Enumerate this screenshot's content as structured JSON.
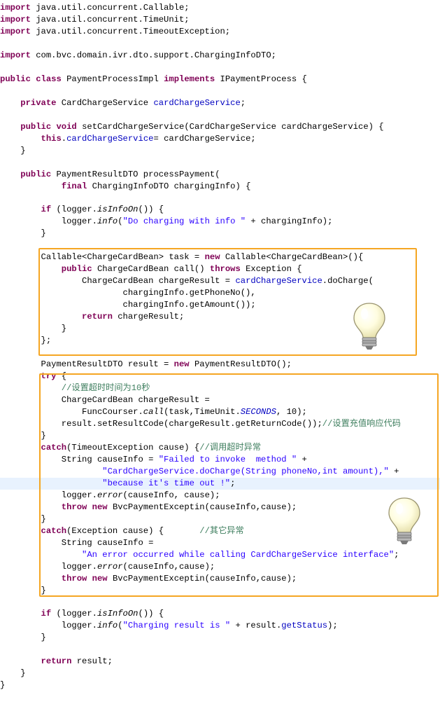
{
  "code_lines": [
    [
      {
        "t": "import",
        "c": "kw"
      },
      {
        "t": " java.util.concurrent.Callable;"
      }
    ],
    [
      {
        "t": "import",
        "c": "kw"
      },
      {
        "t": " java.util.concurrent.TimeUnit;"
      }
    ],
    [
      {
        "t": "import",
        "c": "kw"
      },
      {
        "t": " java.util.concurrent.TimeoutException;"
      }
    ],
    [],
    [
      {
        "t": "import",
        "c": "kw"
      },
      {
        "t": " com.bvc.domain.ivr.dto.support.ChargingInfoDTO;"
      }
    ],
    [],
    [
      {
        "t": "public",
        "c": "kw"
      },
      {
        "t": " "
      },
      {
        "t": "class",
        "c": "kw"
      },
      {
        "t": " PaymentProcessImpl "
      },
      {
        "t": "implements",
        "c": "kw"
      },
      {
        "t": " IPaymentProcess {"
      }
    ],
    [],
    [
      {
        "t": "    "
      },
      {
        "t": "private",
        "c": "kw"
      },
      {
        "t": " CardChargeService "
      },
      {
        "t": "cardChargeService",
        "c": "fld"
      },
      {
        "t": ";"
      }
    ],
    [],
    [
      {
        "t": "    "
      },
      {
        "t": "public",
        "c": "kw"
      },
      {
        "t": " "
      },
      {
        "t": "void",
        "c": "kw"
      },
      {
        "t": " setCardChargeService(CardChargeService cardChargeService) {"
      }
    ],
    [
      {
        "t": "        "
      },
      {
        "t": "this",
        "c": "kw"
      },
      {
        "t": "."
      },
      {
        "t": "cardChargeService",
        "c": "fld"
      },
      {
        "t": "= cardChargeService;"
      }
    ],
    [
      {
        "t": "    }"
      }
    ],
    [],
    [
      {
        "t": "    "
      },
      {
        "t": "public",
        "c": "kw"
      },
      {
        "t": " PaymentResultDTO processPayment("
      }
    ],
    [
      {
        "t": "            "
      },
      {
        "t": "final",
        "c": "kw"
      },
      {
        "t": " ChargingInfoDTO chargingInfo) {"
      }
    ],
    [],
    [
      {
        "t": "        "
      },
      {
        "t": "if",
        "c": "kw"
      },
      {
        "t": " (logger."
      },
      {
        "t": "isInfoOn",
        "c": "itl"
      },
      {
        "t": "()) {"
      }
    ],
    [
      {
        "t": "            logger."
      },
      {
        "t": "info",
        "c": "itl"
      },
      {
        "t": "("
      },
      {
        "t": "\"Do charging with info \"",
        "c": "str"
      },
      {
        "t": " + chargingInfo);"
      }
    ],
    [
      {
        "t": "        }"
      }
    ],
    [],
    [
      {
        "t": "        Callable<ChargeCardBean> task = "
      },
      {
        "t": "new",
        "c": "kw"
      },
      {
        "t": " Callable<ChargeCardBean>(){"
      }
    ],
    [
      {
        "t": "            "
      },
      {
        "t": "public",
        "c": "kw"
      },
      {
        "t": " ChargeCardBean call() "
      },
      {
        "t": "throws",
        "c": "kw"
      },
      {
        "t": " Exception {"
      }
    ],
    [
      {
        "t": "                ChargeCardBean chargeResult = "
      },
      {
        "t": "cardChargeService",
        "c": "fld"
      },
      {
        "t": ".doCharge("
      }
    ],
    [
      {
        "t": "                        chargingInfo.getPhoneNo(),"
      }
    ],
    [
      {
        "t": "                        chargingInfo.getAmount());"
      }
    ],
    [
      {
        "t": "                "
      },
      {
        "t": "return",
        "c": "kw"
      },
      {
        "t": " chargeResult;"
      }
    ],
    [
      {
        "t": "            }"
      }
    ],
    [
      {
        "t": "        };"
      }
    ],
    [],
    [
      {
        "t": "        PaymentResultDTO result = "
      },
      {
        "t": "new",
        "c": "kw"
      },
      {
        "t": " PaymentResultDTO();"
      }
    ],
    [
      {
        "t": "        "
      },
      {
        "t": "try",
        "c": "kw"
      },
      {
        "t": " {"
      }
    ],
    [
      {
        "t": "            "
      },
      {
        "t": "//设置超时时间为10秒",
        "c": "cmt"
      }
    ],
    [
      {
        "t": "            ChargeCardBean chargeResult ="
      }
    ],
    [
      {
        "t": "                FuncCourser."
      },
      {
        "t": "call",
        "c": "itl"
      },
      {
        "t": "(task,TimeUnit."
      },
      {
        "t": "SECONDS",
        "c": "sitl"
      },
      {
        "t": ", 10);"
      }
    ],
    [
      {
        "t": "            result.setResultCode(chargeResult.getReturnCode());"
      },
      {
        "t": "//设置充值响应代码",
        "c": "cmt"
      }
    ],
    [
      {
        "t": "        }"
      }
    ],
    [
      {
        "t": "        "
      },
      {
        "t": "catch",
        "c": "kw"
      },
      {
        "t": "(TimeoutException cause) {"
      },
      {
        "t": "//调用超时异常",
        "c": "cmt"
      }
    ],
    [
      {
        "t": "            String causeInfo = "
      },
      {
        "t": "\"Failed to invoke  method \"",
        "c": "str"
      },
      {
        "t": " +"
      }
    ],
    [
      {
        "t": "                    "
      },
      {
        "t": "\"CardChargeService.doCharge(String phoneNo,int amount),\"",
        "c": "str"
      },
      {
        "t": " +"
      }
    ],
    [
      {
        "t": "                    "
      },
      {
        "t": "\"because it's time out !\"",
        "c": "str"
      },
      {
        "t": ";"
      }
    ],
    [
      {
        "t": "            logger."
      },
      {
        "t": "error",
        "c": "itl"
      },
      {
        "t": "(causeInfo, cause);"
      }
    ],
    [
      {
        "t": "            "
      },
      {
        "t": "throw",
        "c": "kw"
      },
      {
        "t": " "
      },
      {
        "t": "new",
        "c": "kw"
      },
      {
        "t": " BvcPaymentExceptin(causeInfo,cause);"
      }
    ],
    [
      {
        "t": "        }"
      }
    ],
    [
      {
        "t": "        "
      },
      {
        "t": "catch",
        "c": "kw"
      },
      {
        "t": "(Exception cause) {       "
      },
      {
        "t": "//其它异常",
        "c": "cmt"
      }
    ],
    [
      {
        "t": "            String causeInfo ="
      }
    ],
    [
      {
        "t": "                "
      },
      {
        "t": "\"An error occurred while calling CardChargeService interface\"",
        "c": "str"
      },
      {
        "t": ";"
      }
    ],
    [
      {
        "t": "            logger."
      },
      {
        "t": "error",
        "c": "itl"
      },
      {
        "t": "(causeInfo,cause);"
      }
    ],
    [
      {
        "t": "            "
      },
      {
        "t": "throw",
        "c": "kw"
      },
      {
        "t": " "
      },
      {
        "t": "new",
        "c": "kw"
      },
      {
        "t": " BvcPaymentExceptin(causeInfo,cause);"
      }
    ],
    [
      {
        "t": "        }"
      }
    ],
    [],
    [
      {
        "t": "        "
      },
      {
        "t": "if",
        "c": "kw"
      },
      {
        "t": " (logger."
      },
      {
        "t": "isInfoOn",
        "c": "itl"
      },
      {
        "t": "()) {"
      }
    ],
    [
      {
        "t": "            logger."
      },
      {
        "t": "info",
        "c": "itl"
      },
      {
        "t": "("
      },
      {
        "t": "\"Charging result is \"",
        "c": "str"
      },
      {
        "t": " + result."
      },
      {
        "t": "getStatus",
        "c": "fld"
      },
      {
        "t": ");"
      }
    ],
    [
      {
        "t": "        }"
      }
    ],
    [],
    [
      {
        "t": "        "
      },
      {
        "t": "return",
        "c": "kw"
      },
      {
        "t": " result;"
      }
    ],
    [
      {
        "t": "    }"
      }
    ],
    [
      {
        "t": "}"
      }
    ]
  ],
  "highlighted_line": 40,
  "colors": {
    "keyword": "#7f0055",
    "field": "#0000c0",
    "string": "#2a00ff",
    "comment": "#3f7f5f",
    "highlight_box": "#f5a623",
    "current_line": "#e8f2fe"
  },
  "icons": {
    "annotation_icon": "lightbulb-icon"
  }
}
